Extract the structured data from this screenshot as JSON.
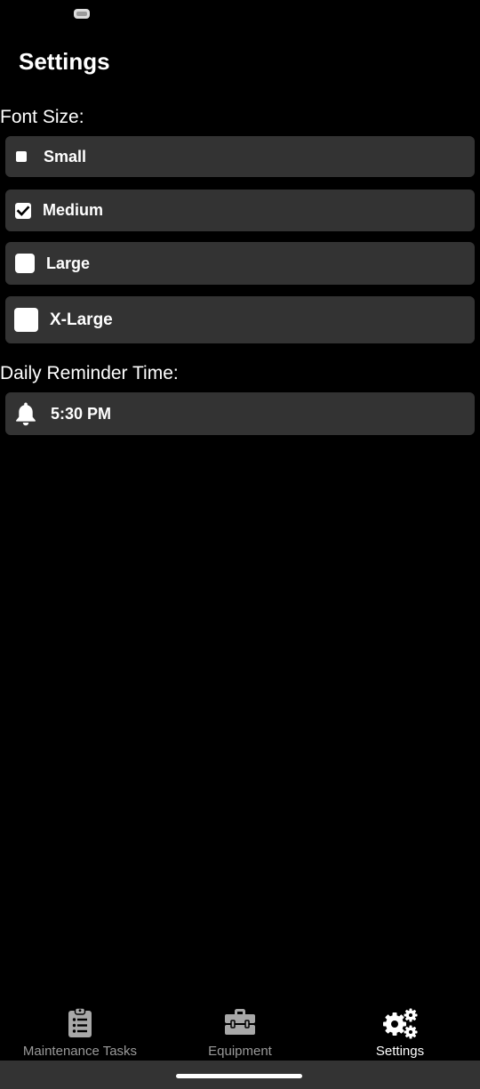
{
  "page": {
    "title": "Settings"
  },
  "font_size": {
    "label": "Font Size:",
    "options": [
      {
        "label": "Small",
        "checked": false
      },
      {
        "label": "Medium",
        "checked": true
      },
      {
        "label": "Large",
        "checked": false
      },
      {
        "label": "X-Large",
        "checked": false
      }
    ]
  },
  "reminder": {
    "label": "Daily Reminder Time:",
    "time": "5:30 PM",
    "icon": "bell-icon"
  },
  "tabs": [
    {
      "label": "Maintenance Tasks",
      "icon": "clipboard-list-icon",
      "active": false
    },
    {
      "label": "Equipment",
      "icon": "toolbox-icon",
      "active": false
    },
    {
      "label": "Settings",
      "icon": "gears-icon",
      "active": true
    }
  ],
  "colors": {
    "background": "#000000",
    "card": "#333333",
    "text": "#ffffff",
    "inactive_tab": "#9a9a9a"
  }
}
